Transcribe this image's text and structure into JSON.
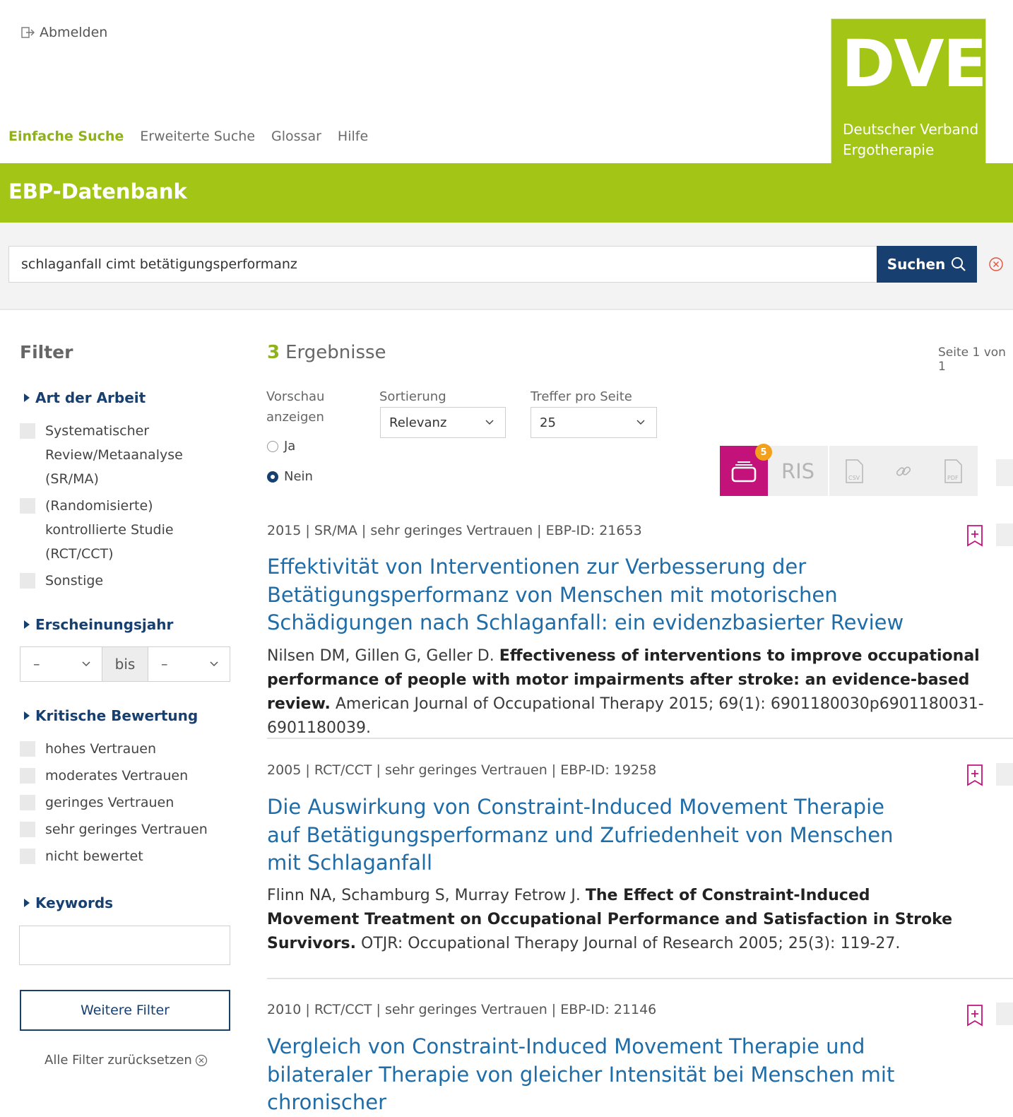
{
  "header": {
    "logout_label": "Abmelden",
    "nav": [
      "Einfache Suche",
      "Erweiterte Suche",
      "Glossar",
      "Hilfe"
    ],
    "logo": {
      "big": "DVE",
      "line1": "Deutscher Verband",
      "line2": "Ergotherapie"
    },
    "banner_title": "EBP-Datenbank"
  },
  "search": {
    "value": "schlaganfall cimt betätigungsperformanz",
    "button_label": "Suchen"
  },
  "filter": {
    "title": "Filter",
    "art": {
      "label": "Art der Arbeit",
      "options": [
        "Systematischer Review/Metaanalyse (SR/MA)",
        "(Randomisierte) kontrollierte Studie (RCT/CCT)",
        "Sonstige"
      ]
    },
    "jahr": {
      "label": "Erscheinungsjahr",
      "from": "–",
      "to_label": "bis",
      "to": "–"
    },
    "bewertung": {
      "label": "Kritische Bewertung",
      "options": [
        "hohes Vertrauen",
        "moderates Vertrauen",
        "geringes Vertrauen",
        "sehr geringes Vertrauen",
        "nicht bewertet"
      ]
    },
    "keywords": {
      "label": "Keywords"
    },
    "more_label": "Weitere Filter",
    "reset_label": "Alle Filter zurücksetzen"
  },
  "results": {
    "count": "3",
    "count_label": "Ergebnisse",
    "page_info": "Seite 1 von 1",
    "preview": {
      "label": "Vorschau anzeigen",
      "yes": "Ja",
      "no": "Nein",
      "selected": "Nein"
    },
    "sort": {
      "label": "Sortierung",
      "value": "Relevanz"
    },
    "per_page": {
      "label": "Treffer pro Seite",
      "value": "25"
    },
    "export": {
      "cart_count": "5",
      "ris": "RIS",
      "csv": "CSV",
      "pdf": "PDF"
    },
    "items": [
      {
        "meta": "2015 | SR/MA | sehr geringes Vertrauen | EBP-ID: 21653",
        "title": "Effektivität von Interventionen zur Verbesserung der Betätigungsperformanz von Menschen mit motorischen Schädigungen nach Schlaganfall: ein evidenzbasierter Review",
        "authors": "Nilsen DM, Gillen G, Geller D.",
        "article": "Effectiveness of interventions to improve occupational performance of people with motor impairments after stroke: an evidence-based review.",
        "source": "American Journal of Occupational Therapy 2015; 69(1): 6901180030p6901180031-6901180039."
      },
      {
        "meta": "2005 | RCT/CCT | sehr geringes Vertrauen | EBP-ID: 19258",
        "title": "Die Auswirkung von Constraint-Induced Movement Therapie auf Betätigungsperformanz und Zufriedenheit von Menschen mit Schlaganfall",
        "authors": "Flinn NA, Schamburg S, Murray Fetrow J.",
        "article": "The Effect of Constraint-Induced Movement Treatment on Occupational Performance and Satisfaction in Stroke Survivors.",
        "source": "OTJR: Occupational Therapy Journal of Research 2005; 25(3): 119-27."
      },
      {
        "meta": "2010 | RCT/CCT | sehr geringes Vertrauen | EBP-ID: 21146",
        "title": "Vergleich von Constraint-Induced Movement Therapie und bilateraler Therapie von gleicher Intensität bei Menschen mit chronischer"
      }
    ]
  },
  "colors": {
    "brand_green": "#a2c516",
    "navy": "#173f6f",
    "link_blue": "#1e6ca8",
    "magenta": "#c3137b",
    "badge_orange": "#f3a11a"
  },
  "icons": {
    "logout": "logout-icon",
    "search": "search-icon",
    "clear": "clear-circle-x-icon",
    "cart": "cart-icon",
    "csv": "csv-file-icon",
    "link": "link-icon",
    "pdf": "pdf-file-icon",
    "bookmark": "bookmark-plus-icon"
  }
}
